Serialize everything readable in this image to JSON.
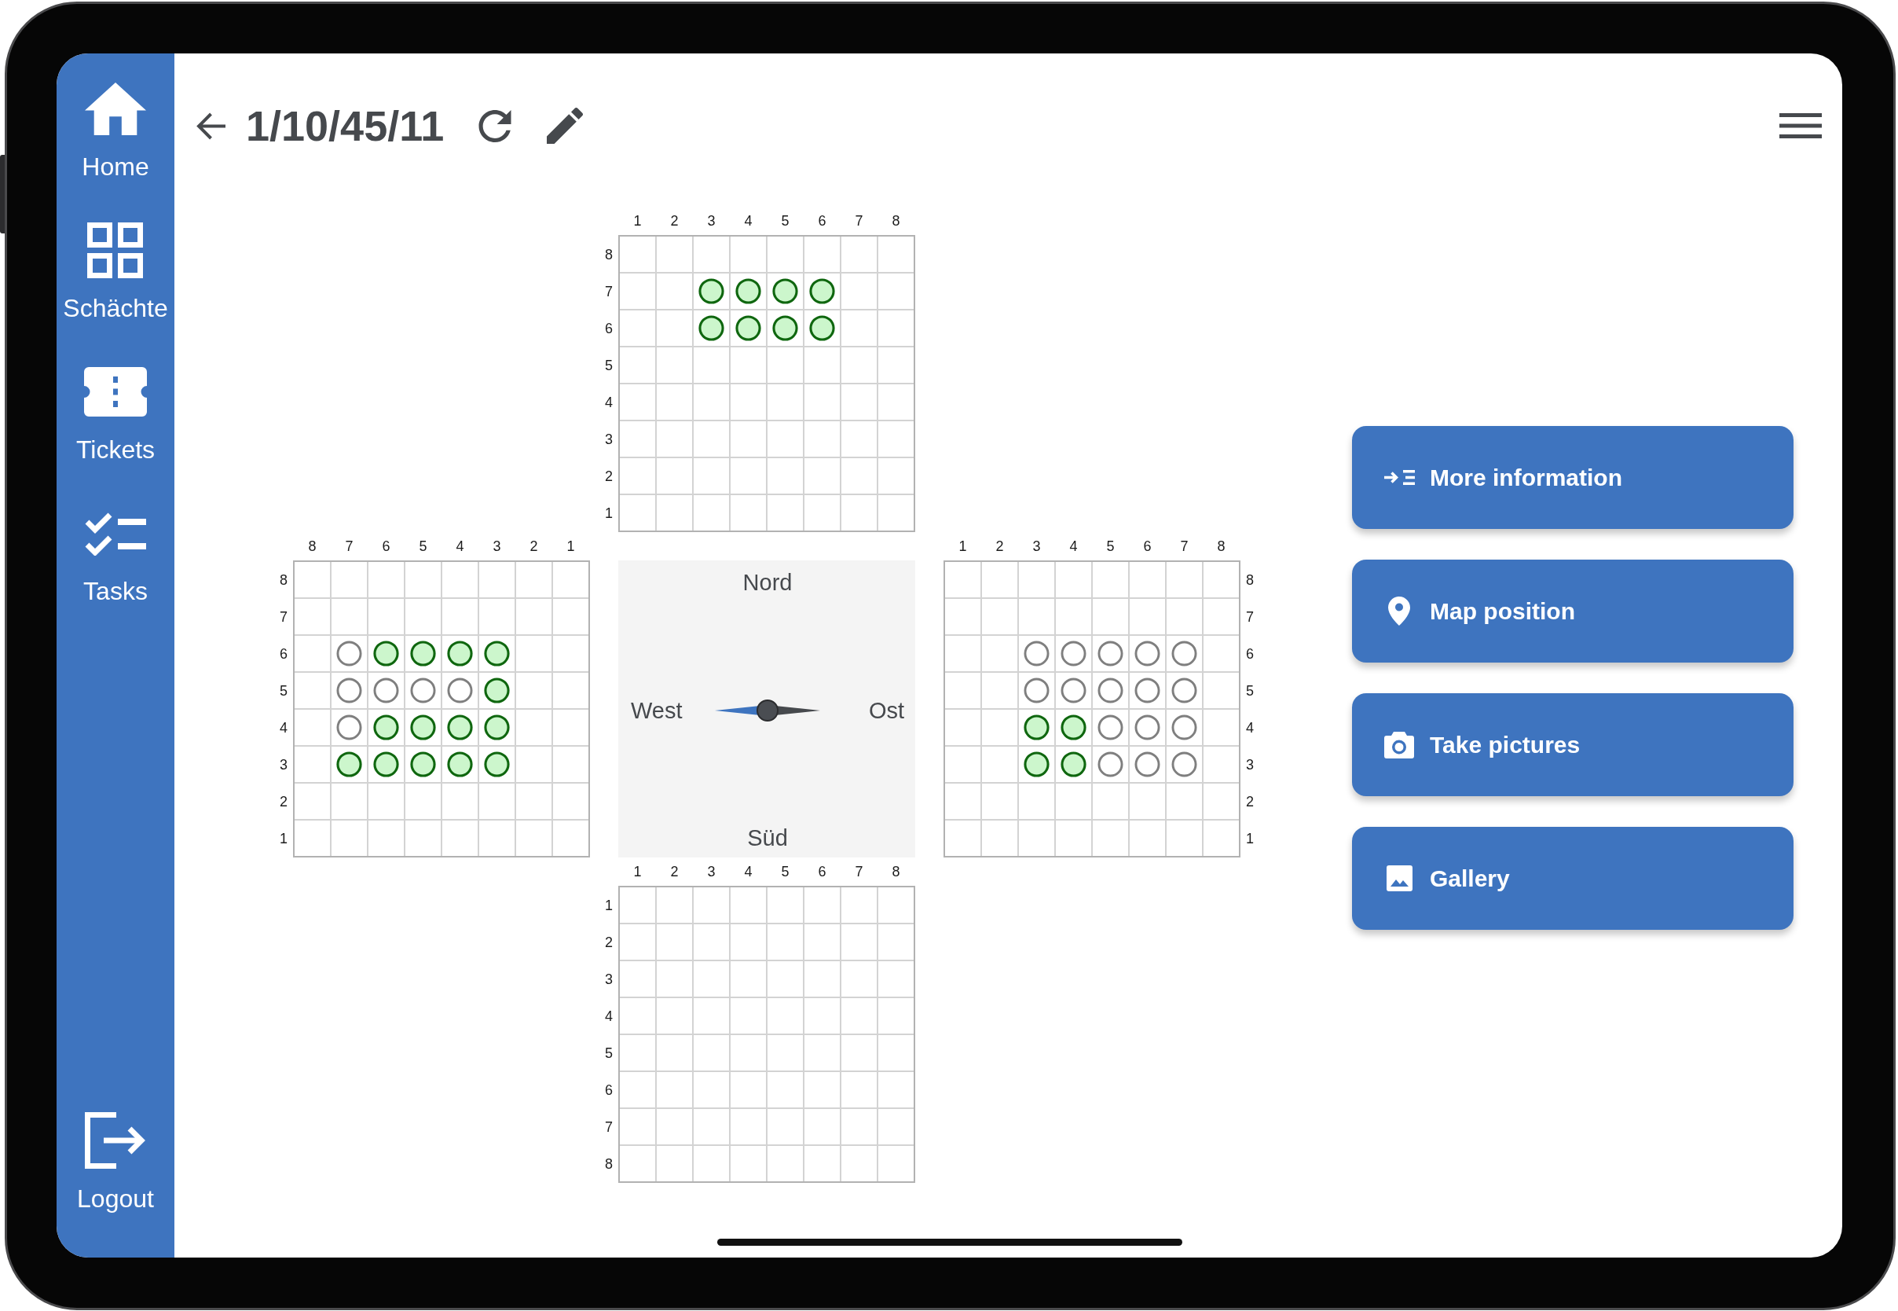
{
  "sidebar": {
    "items": [
      {
        "label": "Home"
      },
      {
        "label": "Schächte"
      },
      {
        "label": "Tickets"
      },
      {
        "label": "Tasks"
      }
    ],
    "footer_item": {
      "label": "Logout"
    }
  },
  "header": {
    "title": "1/10/45/11"
  },
  "boards": [
    {
      "column_labels": [
        "1",
        "2",
        "3",
        "4",
        "5",
        "6",
        "7",
        "8"
      ],
      "rows": [
        {
          "label": "8",
          "cells": [
            {
              "kind": "none"
            },
            {
              "kind": "none"
            },
            {
              "kind": "none"
            },
            {
              "kind": "none"
            },
            {
              "kind": "none"
            },
            {
              "kind": "none"
            },
            {
              "kind": "none"
            },
            {
              "kind": "none"
            }
          ]
        },
        {
          "label": "7",
          "cells": [
            {
              "kind": "none"
            },
            {
              "kind": "none"
            },
            {
              "kind": "filled"
            },
            {
              "kind": "filled"
            },
            {
              "kind": "filled"
            },
            {
              "kind": "filled"
            },
            {
              "kind": "none"
            },
            {
              "kind": "none"
            }
          ]
        },
        {
          "label": "6",
          "cells": [
            {
              "kind": "none"
            },
            {
              "kind": "none"
            },
            {
              "kind": "filled"
            },
            {
              "kind": "filled"
            },
            {
              "kind": "filled"
            },
            {
              "kind": "filled"
            },
            {
              "kind": "none"
            },
            {
              "kind": "none"
            }
          ]
        },
        {
          "label": "5",
          "cells": [
            {
              "kind": "none"
            },
            {
              "kind": "none"
            },
            {
              "kind": "none"
            },
            {
              "kind": "none"
            },
            {
              "kind": "none"
            },
            {
              "kind": "none"
            },
            {
              "kind": "none"
            },
            {
              "kind": "none"
            }
          ]
        },
        {
          "label": "4",
          "cells": [
            {
              "kind": "none"
            },
            {
              "kind": "none"
            },
            {
              "kind": "none"
            },
            {
              "kind": "none"
            },
            {
              "kind": "none"
            },
            {
              "kind": "none"
            },
            {
              "kind": "none"
            },
            {
              "kind": "none"
            }
          ]
        },
        {
          "label": "3",
          "cells": [
            {
              "kind": "none"
            },
            {
              "kind": "none"
            },
            {
              "kind": "none"
            },
            {
              "kind": "none"
            },
            {
              "kind": "none"
            },
            {
              "kind": "none"
            },
            {
              "kind": "none"
            },
            {
              "kind": "none"
            }
          ]
        },
        {
          "label": "2",
          "cells": [
            {
              "kind": "none"
            },
            {
              "kind": "none"
            },
            {
              "kind": "none"
            },
            {
              "kind": "none"
            },
            {
              "kind": "none"
            },
            {
              "kind": "none"
            },
            {
              "kind": "none"
            },
            {
              "kind": "none"
            }
          ]
        },
        {
          "label": "1",
          "cells": [
            {
              "kind": "none"
            },
            {
              "kind": "none"
            },
            {
              "kind": "none"
            },
            {
              "kind": "none"
            },
            {
              "kind": "none"
            },
            {
              "kind": "none"
            },
            {
              "kind": "none"
            },
            {
              "kind": "none"
            }
          ]
        }
      ]
    },
    {
      "column_labels": [
        "8",
        "7",
        "6",
        "5",
        "4",
        "3",
        "2",
        "1"
      ],
      "rows": [
        {
          "label": "8",
          "cells": [
            {
              "kind": "none"
            },
            {
              "kind": "none"
            },
            {
              "kind": "none"
            },
            {
              "kind": "none"
            },
            {
              "kind": "none"
            },
            {
              "kind": "none"
            },
            {
              "kind": "none"
            },
            {
              "kind": "none"
            }
          ]
        },
        {
          "label": "7",
          "cells": [
            {
              "kind": "none"
            },
            {
              "kind": "none"
            },
            {
              "kind": "none"
            },
            {
              "kind": "none"
            },
            {
              "kind": "none"
            },
            {
              "kind": "none"
            },
            {
              "kind": "none"
            },
            {
              "kind": "none"
            }
          ]
        },
        {
          "label": "6",
          "cells": [
            {
              "kind": "none"
            },
            {
              "kind": "open"
            },
            {
              "kind": "filled"
            },
            {
              "kind": "filled"
            },
            {
              "kind": "filled"
            },
            {
              "kind": "filled"
            },
            {
              "kind": "none"
            },
            {
              "kind": "none"
            }
          ]
        },
        {
          "label": "5",
          "cells": [
            {
              "kind": "none"
            },
            {
              "kind": "open"
            },
            {
              "kind": "open"
            },
            {
              "kind": "open"
            },
            {
              "kind": "open"
            },
            {
              "kind": "filled"
            },
            {
              "kind": "none"
            },
            {
              "kind": "none"
            }
          ]
        },
        {
          "label": "4",
          "cells": [
            {
              "kind": "none"
            },
            {
              "kind": "open"
            },
            {
              "kind": "filled"
            },
            {
              "kind": "filled"
            },
            {
              "kind": "filled"
            },
            {
              "kind": "filled"
            },
            {
              "kind": "none"
            },
            {
              "kind": "none"
            }
          ]
        },
        {
          "label": "3",
          "cells": [
            {
              "kind": "none"
            },
            {
              "kind": "filled"
            },
            {
              "kind": "filled"
            },
            {
              "kind": "filled"
            },
            {
              "kind": "filled"
            },
            {
              "kind": "filled"
            },
            {
              "kind": "none"
            },
            {
              "kind": "none"
            }
          ]
        },
        {
          "label": "2",
          "cells": [
            {
              "kind": "none"
            },
            {
              "kind": "none"
            },
            {
              "kind": "none"
            },
            {
              "kind": "none"
            },
            {
              "kind": "none"
            },
            {
              "kind": "none"
            },
            {
              "kind": "none"
            },
            {
              "kind": "none"
            }
          ]
        },
        {
          "label": "1",
          "cells": [
            {
              "kind": "none"
            },
            {
              "kind": "none"
            },
            {
              "kind": "none"
            },
            {
              "kind": "none"
            },
            {
              "kind": "none"
            },
            {
              "kind": "none"
            },
            {
              "kind": "none"
            },
            {
              "kind": "none"
            }
          ]
        }
      ]
    },
    {
      "column_labels": [
        "1",
        "2",
        "3",
        "4",
        "5",
        "6",
        "7",
        "8"
      ],
      "rows": [
        {
          "label": "8",
          "cells": [
            {
              "kind": "none"
            },
            {
              "kind": "none"
            },
            {
              "kind": "none"
            },
            {
              "kind": "none"
            },
            {
              "kind": "none"
            },
            {
              "kind": "none"
            },
            {
              "kind": "none"
            },
            {
              "kind": "none"
            }
          ]
        },
        {
          "label": "7",
          "cells": [
            {
              "kind": "none"
            },
            {
              "kind": "none"
            },
            {
              "kind": "none"
            },
            {
              "kind": "none"
            },
            {
              "kind": "none"
            },
            {
              "kind": "none"
            },
            {
              "kind": "none"
            },
            {
              "kind": "none"
            }
          ]
        },
        {
          "label": "6",
          "cells": [
            {
              "kind": "none"
            },
            {
              "kind": "none"
            },
            {
              "kind": "open"
            },
            {
              "kind": "open"
            },
            {
              "kind": "open"
            },
            {
              "kind": "open"
            },
            {
              "kind": "open"
            },
            {
              "kind": "none"
            }
          ]
        },
        {
          "label": "5",
          "cells": [
            {
              "kind": "none"
            },
            {
              "kind": "none"
            },
            {
              "kind": "open"
            },
            {
              "kind": "open"
            },
            {
              "kind": "open"
            },
            {
              "kind": "open"
            },
            {
              "kind": "open"
            },
            {
              "kind": "none"
            }
          ]
        },
        {
          "label": "4",
          "cells": [
            {
              "kind": "none"
            },
            {
              "kind": "none"
            },
            {
              "kind": "filled"
            },
            {
              "kind": "filled"
            },
            {
              "kind": "open"
            },
            {
              "kind": "open"
            },
            {
              "kind": "open"
            },
            {
              "kind": "none"
            }
          ]
        },
        {
          "label": "3",
          "cells": [
            {
              "kind": "none"
            },
            {
              "kind": "none"
            },
            {
              "kind": "filled"
            },
            {
              "kind": "filled"
            },
            {
              "kind": "open"
            },
            {
              "kind": "open"
            },
            {
              "kind": "open"
            },
            {
              "kind": "none"
            }
          ]
        },
        {
          "label": "2",
          "cells": [
            {
              "kind": "none"
            },
            {
              "kind": "none"
            },
            {
              "kind": "none"
            },
            {
              "kind": "none"
            },
            {
              "kind": "none"
            },
            {
              "kind": "none"
            },
            {
              "kind": "none"
            },
            {
              "kind": "none"
            }
          ]
        },
        {
          "label": "1",
          "cells": [
            {
              "kind": "none"
            },
            {
              "kind": "none"
            },
            {
              "kind": "none"
            },
            {
              "kind": "none"
            },
            {
              "kind": "none"
            },
            {
              "kind": "none"
            },
            {
              "kind": "none"
            },
            {
              "kind": "none"
            }
          ]
        }
      ]
    },
    {
      "column_labels": [
        "1",
        "2",
        "3",
        "4",
        "5",
        "6",
        "7",
        "8"
      ],
      "rows": [
        {
          "label": "1",
          "cells": [
            {
              "kind": "none"
            },
            {
              "kind": "none"
            },
            {
              "kind": "none"
            },
            {
              "kind": "none"
            },
            {
              "kind": "none"
            },
            {
              "kind": "none"
            },
            {
              "kind": "none"
            },
            {
              "kind": "none"
            }
          ]
        },
        {
          "label": "2",
          "cells": [
            {
              "kind": "none"
            },
            {
              "kind": "none"
            },
            {
              "kind": "none"
            },
            {
              "kind": "none"
            },
            {
              "kind": "none"
            },
            {
              "kind": "none"
            },
            {
              "kind": "none"
            },
            {
              "kind": "none"
            }
          ]
        },
        {
          "label": "3",
          "cells": [
            {
              "kind": "none"
            },
            {
              "kind": "none"
            },
            {
              "kind": "none"
            },
            {
              "kind": "none"
            },
            {
              "kind": "none"
            },
            {
              "kind": "none"
            },
            {
              "kind": "none"
            },
            {
              "kind": "none"
            }
          ]
        },
        {
          "label": "4",
          "cells": [
            {
              "kind": "none"
            },
            {
              "kind": "none"
            },
            {
              "kind": "none"
            },
            {
              "kind": "none"
            },
            {
              "kind": "none"
            },
            {
              "kind": "none"
            },
            {
              "kind": "none"
            },
            {
              "kind": "none"
            }
          ]
        },
        {
          "label": "5",
          "cells": [
            {
              "kind": "none"
            },
            {
              "kind": "none"
            },
            {
              "kind": "none"
            },
            {
              "kind": "none"
            },
            {
              "kind": "none"
            },
            {
              "kind": "none"
            },
            {
              "kind": "none"
            },
            {
              "kind": "none"
            }
          ]
        },
        {
          "label": "6",
          "cells": [
            {
              "kind": "none"
            },
            {
              "kind": "none"
            },
            {
              "kind": "none"
            },
            {
              "kind": "none"
            },
            {
              "kind": "none"
            },
            {
              "kind": "none"
            },
            {
              "kind": "none"
            },
            {
              "kind": "none"
            }
          ]
        },
        {
          "label": "7",
          "cells": [
            {
              "kind": "none"
            },
            {
              "kind": "none"
            },
            {
              "kind": "none"
            },
            {
              "kind": "none"
            },
            {
              "kind": "none"
            },
            {
              "kind": "none"
            },
            {
              "kind": "none"
            },
            {
              "kind": "none"
            }
          ]
        },
        {
          "label": "8",
          "cells": [
            {
              "kind": "none"
            },
            {
              "kind": "none"
            },
            {
              "kind": "none"
            },
            {
              "kind": "none"
            },
            {
              "kind": "none"
            },
            {
              "kind": "none"
            },
            {
              "kind": "none"
            },
            {
              "kind": "none"
            }
          ]
        }
      ]
    }
  ],
  "compass": {
    "north": "Nord",
    "west": "West",
    "east": "Ost",
    "south": "Süd"
  },
  "actions": [
    {
      "label": "More information"
    },
    {
      "label": "Map position"
    },
    {
      "label": "Take pictures"
    },
    {
      "label": "Gallery"
    }
  ]
}
